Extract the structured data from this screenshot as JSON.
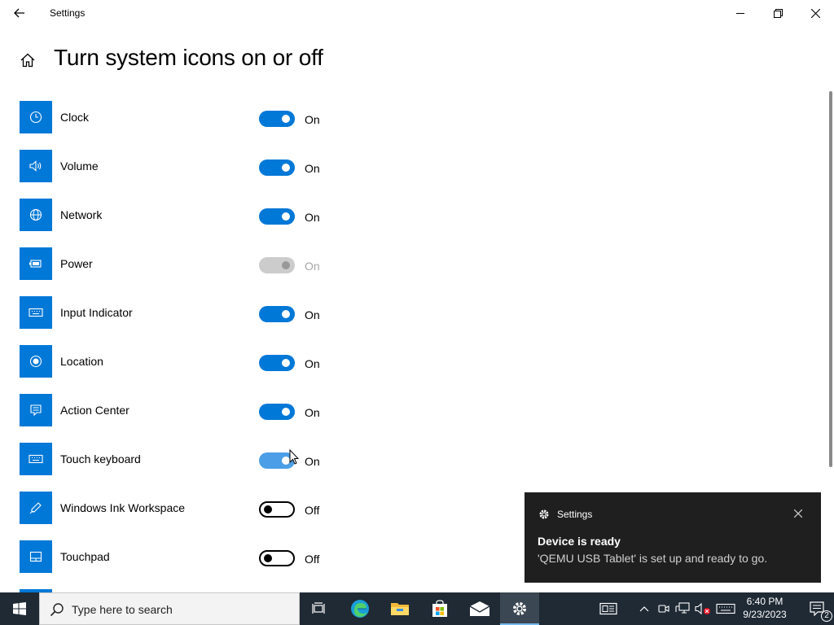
{
  "window": {
    "title": "Settings"
  },
  "page": {
    "title": "Turn system icons on or off"
  },
  "items": [
    {
      "label": "Clock",
      "icon": "clock-icon",
      "state": "On",
      "toggle": "on"
    },
    {
      "label": "Volume",
      "icon": "volume-icon",
      "state": "On",
      "toggle": "on"
    },
    {
      "label": "Network",
      "icon": "network-icon",
      "state": "On",
      "toggle": "on"
    },
    {
      "label": "Power",
      "icon": "battery-icon",
      "state": "On",
      "toggle": "disabled"
    },
    {
      "label": "Input Indicator",
      "icon": "keyboard-icon",
      "state": "On",
      "toggle": "on"
    },
    {
      "label": "Location",
      "icon": "location-icon",
      "state": "On",
      "toggle": "on"
    },
    {
      "label": "Action Center",
      "icon": "action-center-icon",
      "state": "On",
      "toggle": "on"
    },
    {
      "label": "Touch keyboard",
      "icon": "touch-keyboard-icon",
      "state": "On",
      "toggle": "hover"
    },
    {
      "label": "Windows Ink Workspace",
      "icon": "pen-icon",
      "state": "Off",
      "toggle": "off"
    },
    {
      "label": "Touchpad",
      "icon": "touchpad-icon",
      "state": "Off",
      "toggle": "off"
    }
  ],
  "toast": {
    "app": "Settings",
    "title": "Device is ready",
    "body": "'QEMU USB Tablet' is set up and ready to go."
  },
  "taskbar": {
    "search_placeholder": "Type here to search",
    "time": "6:40 PM",
    "date": "9/23/2023",
    "notification_count": "2"
  },
  "colors": {
    "accent": "#0078d7",
    "taskbar": "#1f2a35",
    "toast": "#1f1f1f"
  }
}
